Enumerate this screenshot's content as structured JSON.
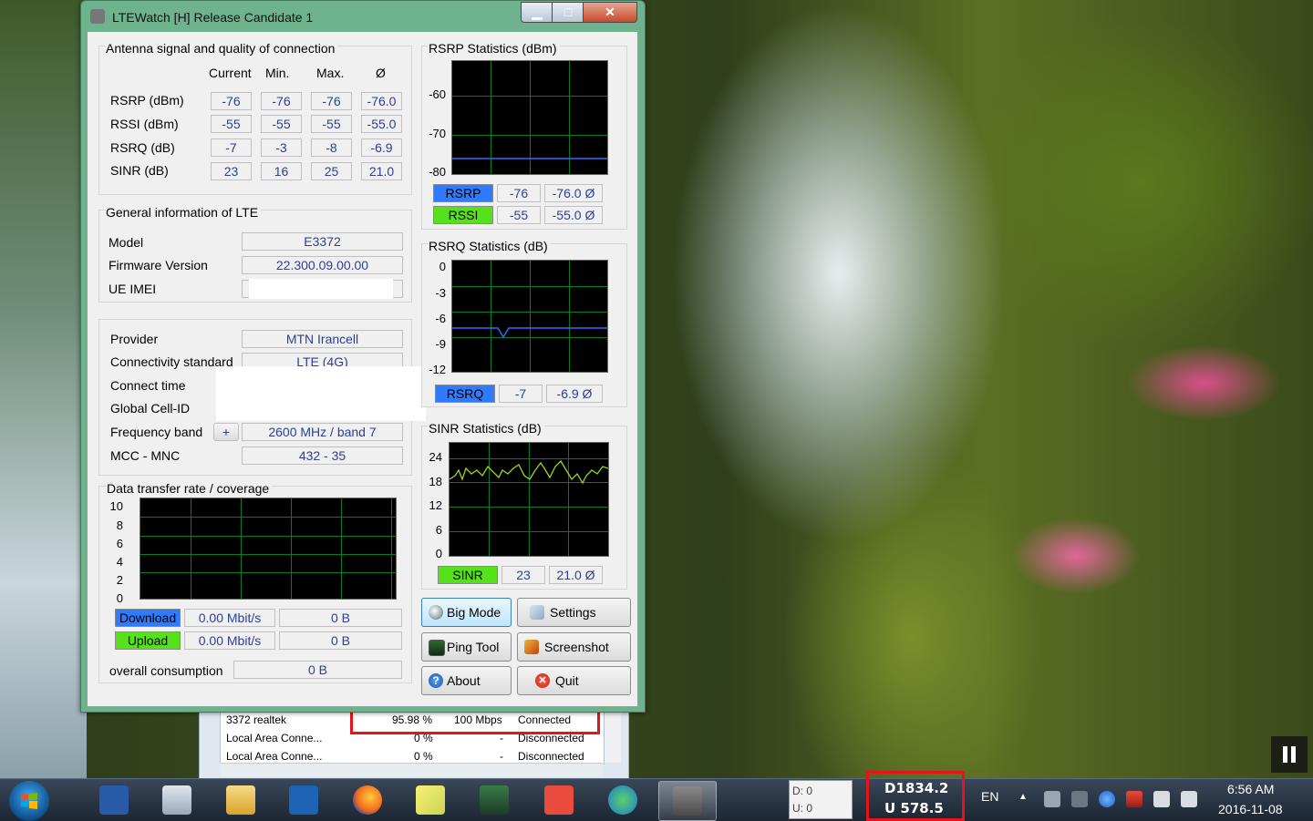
{
  "window": {
    "title": "LTEWatch [H]   Release Candidate 1",
    "min_glyph": "▁",
    "max_glyph": "□",
    "close_glyph": "✕"
  },
  "antenna": {
    "title": "Antenna signal and quality of connection",
    "headers": [
      "Current",
      "Min.",
      "Max.",
      "Ø"
    ],
    "rows": [
      {
        "label": "RSRP (dBm)",
        "values": [
          "-76",
          "-76",
          "-76",
          "-76.0"
        ]
      },
      {
        "label": "RSSI (dBm)",
        "values": [
          "-55",
          "-55",
          "-55",
          "-55.0"
        ]
      },
      {
        "label": "RSRQ (dB)",
        "values": [
          "-7",
          "-3",
          "-8",
          "-6.9"
        ]
      },
      {
        "label": "SINR (dB)",
        "values": [
          "23",
          "16",
          "25",
          "21.0"
        ]
      }
    ]
  },
  "general": {
    "title": "General information of LTE",
    "model_label": "Model",
    "model": "E3372",
    "firmware_label": "Firmware Version",
    "firmware": "22.300.09.00.00",
    "imei_label": "UE IMEI",
    "provider_label": "Provider",
    "provider": "MTN Irancell",
    "conn_std_label": "Connectivity standard",
    "conn_std": "LTE (4G)",
    "connect_time_label": "Connect time",
    "cell_id_label": "Global Cell-ID",
    "freq_label": "Frequency band",
    "freq_button": "+",
    "freq": "2600 MHz / band 7",
    "mcc_label": "MCC - MNC",
    "mcc": "432 - 35"
  },
  "transfer": {
    "title": "Data transfer rate / coverage",
    "y_ticks": [
      "10",
      "8",
      "6",
      "4",
      "2",
      "0"
    ],
    "download_label": "Download",
    "download_rate": "0.00 Mbit/s",
    "download_total": "0 B",
    "upload_label": "Upload",
    "upload_rate": "0.00 Mbit/s",
    "upload_total": "0 B",
    "overall_label": "overall consumption",
    "overall": "0 B"
  },
  "rsrp": {
    "title": "RSRP Statistics (dBm)",
    "y_ticks": [
      "-60",
      "-70",
      "-80"
    ],
    "rsrp_label": "RSRP",
    "rsrp_cur": "-76",
    "rsrp_avg": "-76.0 Ø",
    "rssi_label": "RSSI",
    "rssi_cur": "-55",
    "rssi_avg": "-55.0 Ø"
  },
  "rsrq": {
    "title": "RSRQ Statistics (dB)",
    "y_ticks": [
      "0",
      "-3",
      "-6",
      "-9",
      "-12"
    ],
    "label": "RSRQ",
    "cur": "-7",
    "avg": "-6.9 Ø"
  },
  "sinr": {
    "title": "SINR Statistics (dB)",
    "y_ticks": [
      "24",
      "18",
      "12",
      "6",
      "0"
    ],
    "label": "SINR",
    "cur": "23",
    "avg": "21.0 Ø"
  },
  "buttons": {
    "big_mode": "Big Mode",
    "settings": "Settings",
    "ping_tool": "Ping Tool",
    "screenshot": "Screenshot",
    "about": "About",
    "quit": "Quit"
  },
  "network_list": {
    "rows": [
      {
        "name": "3372 realtek",
        "util": "95.98 %",
        "speed": "100 Mbps",
        "state": "Connected"
      },
      {
        "name": "Local Area Conne...",
        "util": "0 %",
        "speed": "-",
        "state": "Disconnected"
      },
      {
        "name": "Local Area Conne...",
        "util": "0 %",
        "speed": "-",
        "state": "Disconnected"
      }
    ]
  },
  "taskbar": {
    "meter_d": "D: 0",
    "meter_u": "U: 0",
    "speed_d": "D1834.2",
    "speed_u": "U  578.5",
    "lang": "EN",
    "tray_arrow": "▲",
    "time": "6:56 AM",
    "date": "2016-11-08"
  },
  "colors": {
    "rsrp_line": "#2f6bff",
    "sinr_line": "#9bd61c",
    "tag_blue": "#2f7bff",
    "tag_green": "#55e21b",
    "highlight": "#e5141b"
  }
}
